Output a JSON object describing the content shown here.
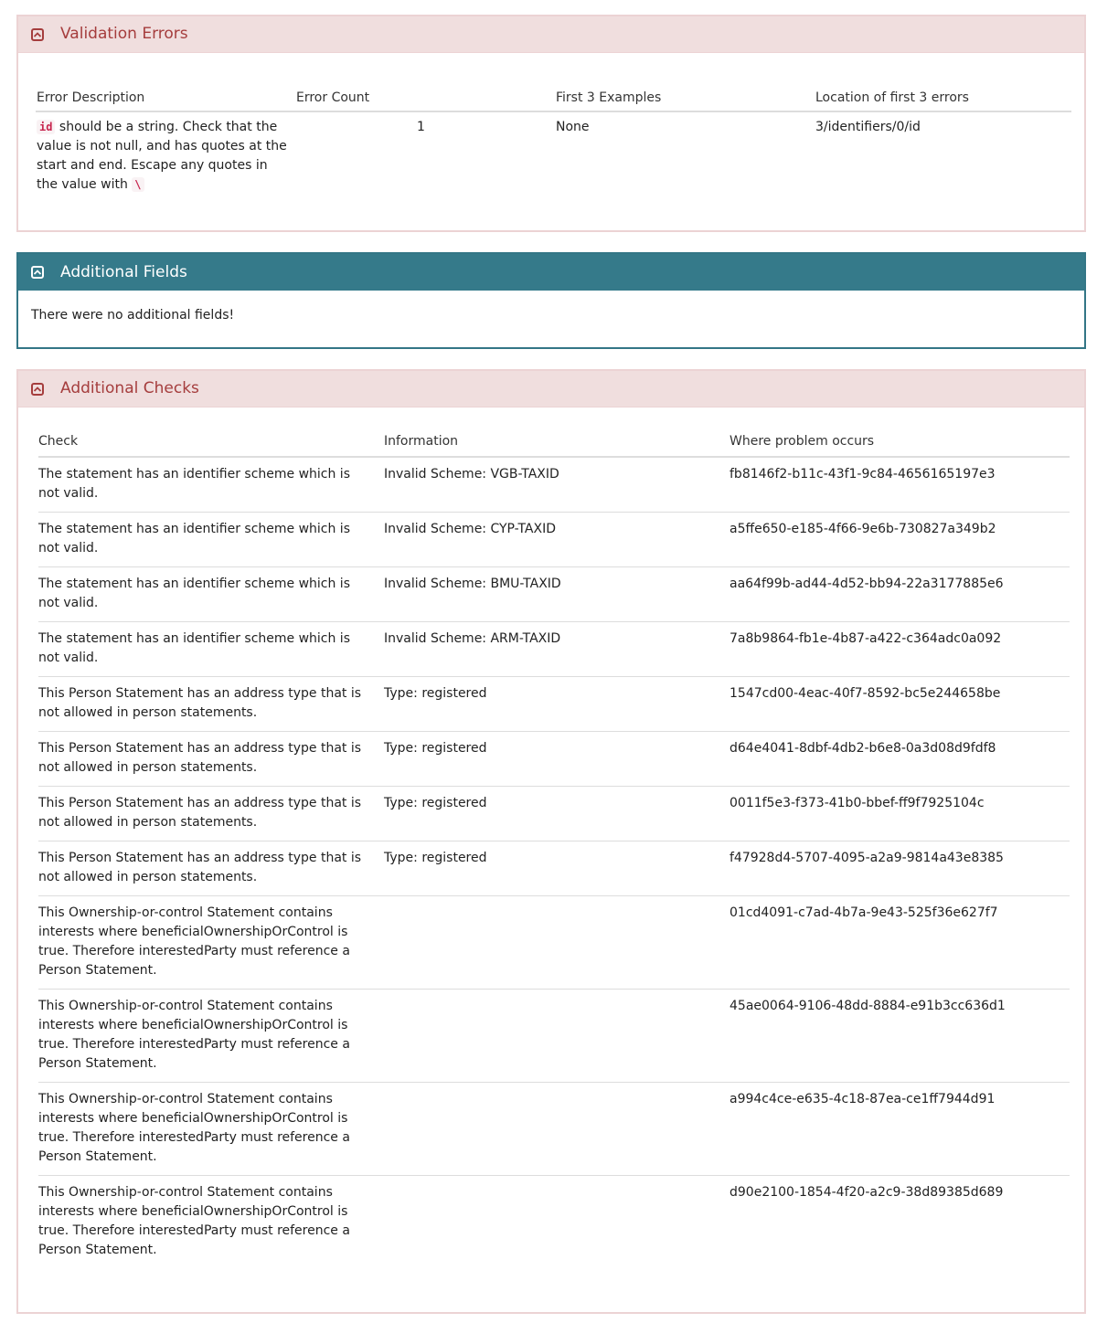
{
  "validation_errors": {
    "title": "Validation Errors",
    "headers": [
      "Error Description",
      "Error Count",
      "First 3 Examples",
      "Location of first 3 errors"
    ],
    "rows": [
      {
        "code": "id",
        "description": " should be a string. Check that the value is not null, and has quotes at the start and end. Escape any quotes in the value with ",
        "escape_char": "\\",
        "count": "1",
        "examples": "None",
        "location": "3/identifiers/0/id"
      }
    ]
  },
  "additional_fields": {
    "title": "Additional Fields",
    "message": "There were no additional fields!"
  },
  "additional_checks": {
    "title": "Additional Checks",
    "headers": [
      "Check",
      "Information",
      "Where problem occurs"
    ],
    "rows": [
      {
        "check": "The statement has an identifier scheme which is not valid.",
        "information": "Invalid Scheme: VGB-TAXID",
        "where": "fb8146f2-b11c-43f1-9c84-4656165197e3"
      },
      {
        "check": "The statement has an identifier scheme which is not valid.",
        "information": "Invalid Scheme: CYP-TAXID",
        "where": "a5ffe650-e185-4f66-9e6b-730827a349b2"
      },
      {
        "check": "The statement has an identifier scheme which is not valid.",
        "information": "Invalid Scheme: BMU-TAXID",
        "where": "aa64f99b-ad44-4d52-bb94-22a3177885e6"
      },
      {
        "check": "The statement has an identifier scheme which is not valid.",
        "information": "Invalid Scheme: ARM-TAXID",
        "where": "7a8b9864-fb1e-4b87-a422-c364adc0a092"
      },
      {
        "check": "This Person Statement has an address type that is not allowed in person statements.",
        "information": "Type: registered",
        "where": "1547cd00-4eac-40f7-8592-bc5e244658be"
      },
      {
        "check": "This Person Statement has an address type that is not allowed in person statements.",
        "information": "Type: registered",
        "where": "d64e4041-8dbf-4db2-b6e8-0a3d08d9fdf8"
      },
      {
        "check": "This Person Statement has an address type that is not allowed in person statements.",
        "information": "Type: registered",
        "where": "0011f5e3-f373-41b0-bbef-ff9f7925104c"
      },
      {
        "check": "This Person Statement has an address type that is not allowed in person statements.",
        "information": "Type: registered",
        "where": "f47928d4-5707-4095-a2a9-9814a43e8385"
      },
      {
        "check": "This Ownership-or-control Statement contains interests where beneficialOwnershipOrControl is true. Therefore interestedParty must reference a Person Statement.",
        "information": "",
        "where": "01cd4091-c7ad-4b7a-9e43-525f36e627f7"
      },
      {
        "check": "This Ownership-or-control Statement contains interests where beneficialOwnershipOrControl is true. Therefore interestedParty must reference a Person Statement.",
        "information": "",
        "where": "45ae0064-9106-48dd-8884-e91b3cc636d1"
      },
      {
        "check": "This Ownership-or-control Statement contains interests where beneficialOwnershipOrControl is true. Therefore interestedParty must reference a Person Statement.",
        "information": "",
        "where": "a994c4ce-e635-4c18-87ea-ce1ff7944d91"
      },
      {
        "check": "This Ownership-or-control Statement contains interests where beneficialOwnershipOrControl is true. Therefore interestedParty must reference a Person Statement.",
        "information": "",
        "where": "d90e2100-1854-4f20-a2c9-38d89385d689"
      }
    ]
  }
}
